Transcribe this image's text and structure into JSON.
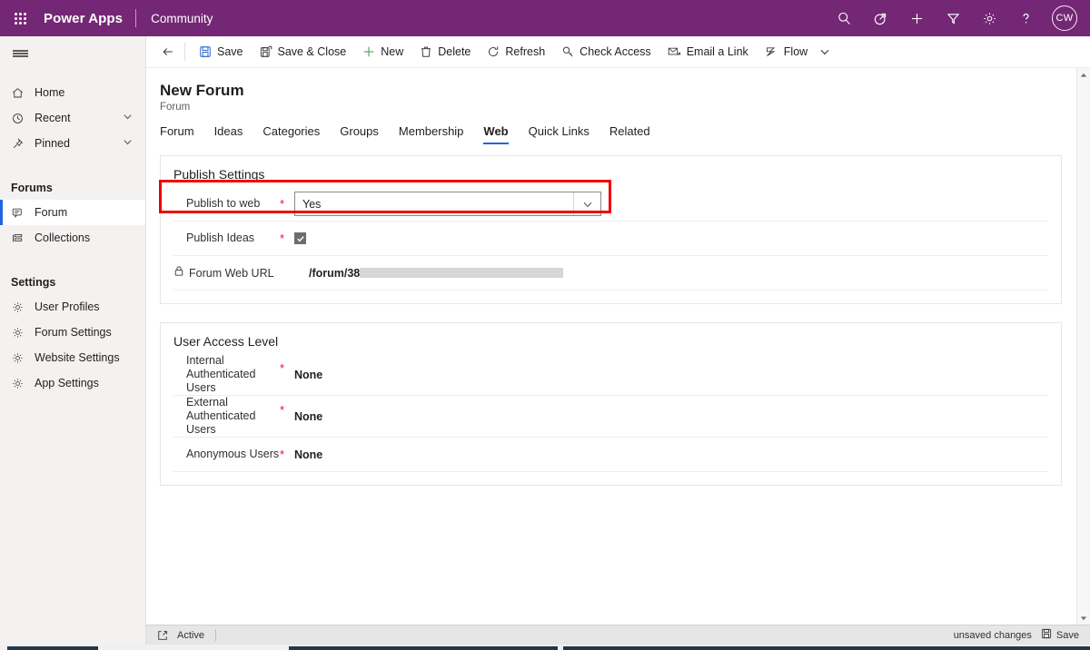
{
  "topbar": {
    "waffle_label": "app-launcher",
    "brand": "Power Apps",
    "app_name": "Community",
    "icons": [
      {
        "name": "search-icon",
        "label": "Search"
      },
      {
        "name": "diagnostics-icon",
        "label": "Diagnostics"
      },
      {
        "name": "plus-icon",
        "label": "New"
      },
      {
        "name": "filter-icon",
        "label": "Filter"
      },
      {
        "name": "gear-icon",
        "label": "Settings"
      },
      {
        "name": "help-icon",
        "label": "Help"
      }
    ],
    "avatar_initials": "CW"
  },
  "sidebar": {
    "items": [
      {
        "label": "Home",
        "icon": "home-icon",
        "chevron": false,
        "selected": false
      },
      {
        "label": "Recent",
        "icon": "clock-icon",
        "chevron": true,
        "selected": false
      },
      {
        "label": "Pinned",
        "icon": "pin-icon",
        "chevron": true,
        "selected": false
      }
    ],
    "group_forums": "Forums",
    "forums_items": [
      {
        "label": "Forum",
        "icon": "forum-icon",
        "selected": true
      },
      {
        "label": "Collections",
        "icon": "collections-icon",
        "selected": false
      }
    ],
    "group_settings": "Settings",
    "settings_items": [
      {
        "label": "User Profiles",
        "icon": "gear-icon"
      },
      {
        "label": "Forum Settings",
        "icon": "gear-icon"
      },
      {
        "label": "Website Settings",
        "icon": "gear-icon"
      },
      {
        "label": "App Settings",
        "icon": "gear-icon"
      }
    ]
  },
  "commandbar": {
    "back_label": "Back",
    "commands": [
      {
        "label": "Save",
        "icon": "save-icon"
      },
      {
        "label": "Save & Close",
        "icon": "save-close-icon"
      },
      {
        "label": "New",
        "icon": "plus-icon"
      },
      {
        "label": "Delete",
        "icon": "trash-icon"
      },
      {
        "label": "Refresh",
        "icon": "refresh-icon"
      },
      {
        "label": "Check Access",
        "icon": "key-icon"
      },
      {
        "label": "Email a Link",
        "icon": "email-icon"
      },
      {
        "label": "Flow",
        "icon": "flow-icon"
      }
    ]
  },
  "record": {
    "title": "New Forum",
    "subtitle": "Forum"
  },
  "tabs": [
    {
      "label": "Forum",
      "active": false
    },
    {
      "label": "Ideas",
      "active": false
    },
    {
      "label": "Categories",
      "active": false
    },
    {
      "label": "Groups",
      "active": false
    },
    {
      "label": "Membership",
      "active": false
    },
    {
      "label": "Web",
      "active": true
    },
    {
      "label": "Quick Links",
      "active": false
    },
    {
      "label": "Related",
      "active": false
    }
  ],
  "publish_settings": {
    "section_title": "Publish Settings",
    "publish_to_web": {
      "label": "Publish to web",
      "required": "*",
      "value": "Yes",
      "highlighted": true
    },
    "publish_ideas": {
      "label": "Publish Ideas",
      "required": "*",
      "checked": true
    },
    "forum_web_url": {
      "label": "Forum Web URL",
      "icon": "lock-icon",
      "value": "/forum/38",
      "redacted": true
    }
  },
  "user_access_level": {
    "section_title": "User Access Level",
    "rows": [
      {
        "label": "Internal Authenticated Users",
        "required": "*",
        "value": "None"
      },
      {
        "label": "External Authenticated Users",
        "required": "*",
        "value": "None"
      },
      {
        "label": "Anonymous Users",
        "required": "*",
        "value": "None"
      }
    ]
  },
  "statusbar": {
    "popout_icon": "popout-icon",
    "state": "Active",
    "unsaved": "unsaved changes",
    "save_label": "Save",
    "save_icon": "save-icon"
  },
  "colors": {
    "brand_purple": "#742774",
    "accent_blue": "#2266dd",
    "highlight_red": "#ee0000",
    "required_red": "#e81123",
    "sidebar_bg": "#f3f2f1",
    "statusbar_bg": "#e6e6e6"
  }
}
